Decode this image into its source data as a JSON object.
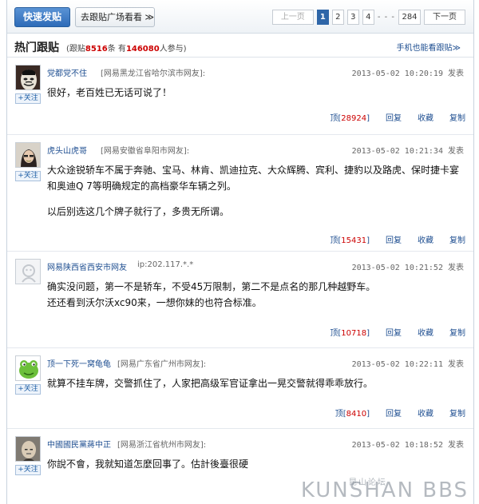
{
  "toolbar": {
    "post_label": "快速发贴",
    "plaza_label": "去跟贴广场看看 ≫"
  },
  "pager": {
    "prev_label": "上一页",
    "pages": [
      "1",
      "2",
      "3",
      "4"
    ],
    "current": "1",
    "dots": "- - -",
    "last": "284",
    "next_label": "下一页"
  },
  "section": {
    "title": "热门跟贴",
    "stat_prefix": "(跟贴",
    "post_count": "8516",
    "stat_mid": "条 有",
    "participant_count": "146080",
    "stat_suffix": "人参与)",
    "mobile_link": "手机也能看跟贴≫"
  },
  "posts": [
    {
      "user": "党都党不住",
      "location": "[网易黑龙江省哈尔滨市网友]:",
      "time": "2013-05-02 10:20:19 发表",
      "follow_label": "+关注",
      "lines": [
        "很好，老百姓已无话可说了！"
      ],
      "ding_prefix": "顶[",
      "ding_count": "28924",
      "ding_suffix": "]",
      "reply": "回复",
      "collect": "收藏",
      "copy": "复制",
      "avatar_icon": "mask-avatar-icon"
    },
    {
      "user": "虎头山虎哥",
      "location": "[网易安徽省阜阳市网友]:",
      "time": "2013-05-02 10:21:34 发表",
      "follow_label": "+关注",
      "lines": [
        "大众途锐轿车不属于奔驰、宝马、林肯、凯迪拉克、大众辉腾、宾利、捷豹以及路虎、保时捷卡宴",
        "和奥迪Q 7等明确规定的高档豪华车辆之列。",
        "",
        "以后别选这几个牌子就行了，多贵无所谓。"
      ],
      "ding_prefix": "顶[",
      "ding_count": "15431",
      "ding_suffix": "]",
      "reply": "回复",
      "collect": "收藏",
      "copy": "复制",
      "avatar_icon": "portrait-avatar-icon"
    },
    {
      "user": "网易陕西省西安市网友",
      "location": "ip:202.117.*.*",
      "time": "2013-05-02 10:21:52 发表",
      "follow_label": "",
      "lines": [
        "确实没问题，第一不是轿车，不受45万限制，第二不是点名的那几种越野车。",
        "还还看到沃尔沃xc90来，一想你妹的也符合标准。"
      ],
      "ding_prefix": "顶[",
      "ding_count": "10718",
      "ding_suffix": "]",
      "reply": "回复",
      "collect": "收藏",
      "copy": "复制",
      "avatar_icon": "default-avatar-icon"
    },
    {
      "user": "顶一下死一窝龟龟",
      "location": "[网易广东省广州市网友]:",
      "time": "2013-05-02 10:22:11 发表",
      "follow_label": "+关注",
      "lines": [
        "就算不挂车牌，交警抓住了，人家把高级军官证拿出一晃交警就得乖乖放行。"
      ],
      "ding_prefix": "顶[",
      "ding_count": "8410",
      "ding_suffix": "]",
      "reply": "回复",
      "collect": "收藏",
      "copy": "复制",
      "avatar_icon": "green-frog-avatar-icon"
    },
    {
      "user": "中國國民黨蔣中正",
      "location": "[网易浙江省杭州市网友]:",
      "time": "2013-05-02 10:18:52 发表",
      "follow_label": "+关注",
      "lines": [
        "你說不會，我就知道怎麼回事了。估計後臺很硬"
      ],
      "avatar_icon": "bald-portrait-avatar-icon"
    }
  ],
  "watermark": {
    "cn": "昆山论坛",
    "en": "KUNSHAN BBS"
  },
  "colors": {
    "accent": "#2f66a8",
    "link": "#1f4f91",
    "count_red": "#cc0000"
  }
}
